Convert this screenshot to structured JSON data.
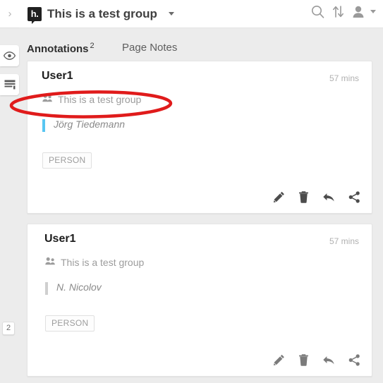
{
  "left_rail": {
    "collapse_chevron": "›",
    "buttons": [
      {
        "name": "highlights-toggle",
        "icon": "eye-icon"
      },
      {
        "name": "new-note",
        "icon": "note-icon"
      }
    ],
    "badge_count": "2"
  },
  "topbar": {
    "logo_text": "h.",
    "group_title": "This is a test group",
    "icons": [
      {
        "name": "search-icon"
      },
      {
        "name": "sort-icon"
      },
      {
        "name": "user-avatar-icon"
      }
    ]
  },
  "tabs": [
    {
      "label": "Annotations",
      "count": "2",
      "active": true
    },
    {
      "label": "Page Notes",
      "count": "",
      "active": false
    }
  ],
  "annotations": [
    {
      "user": "User1",
      "timestamp": "57 mins",
      "group": "This is a test group",
      "quote": "Jörg Tiedemann",
      "tag": "PERSON",
      "quote_bar_color": "#58c6f2",
      "actions": [
        "edit-icon",
        "delete-icon",
        "reply-icon",
        "share-icon"
      ]
    },
    {
      "user": "User1",
      "timestamp": "57 mins",
      "group": "This is a test group",
      "quote": "N. Nicolov",
      "tag": "PERSON",
      "quote_bar_color": "#cfcfcf",
      "actions": [
        "edit-icon",
        "delete-icon",
        "reply-icon",
        "share-icon"
      ]
    }
  ],
  "annotation_overlay": {
    "shape": "red-ellipse",
    "color": "#e01b1b",
    "target": "group-label-of-first-annotation"
  }
}
